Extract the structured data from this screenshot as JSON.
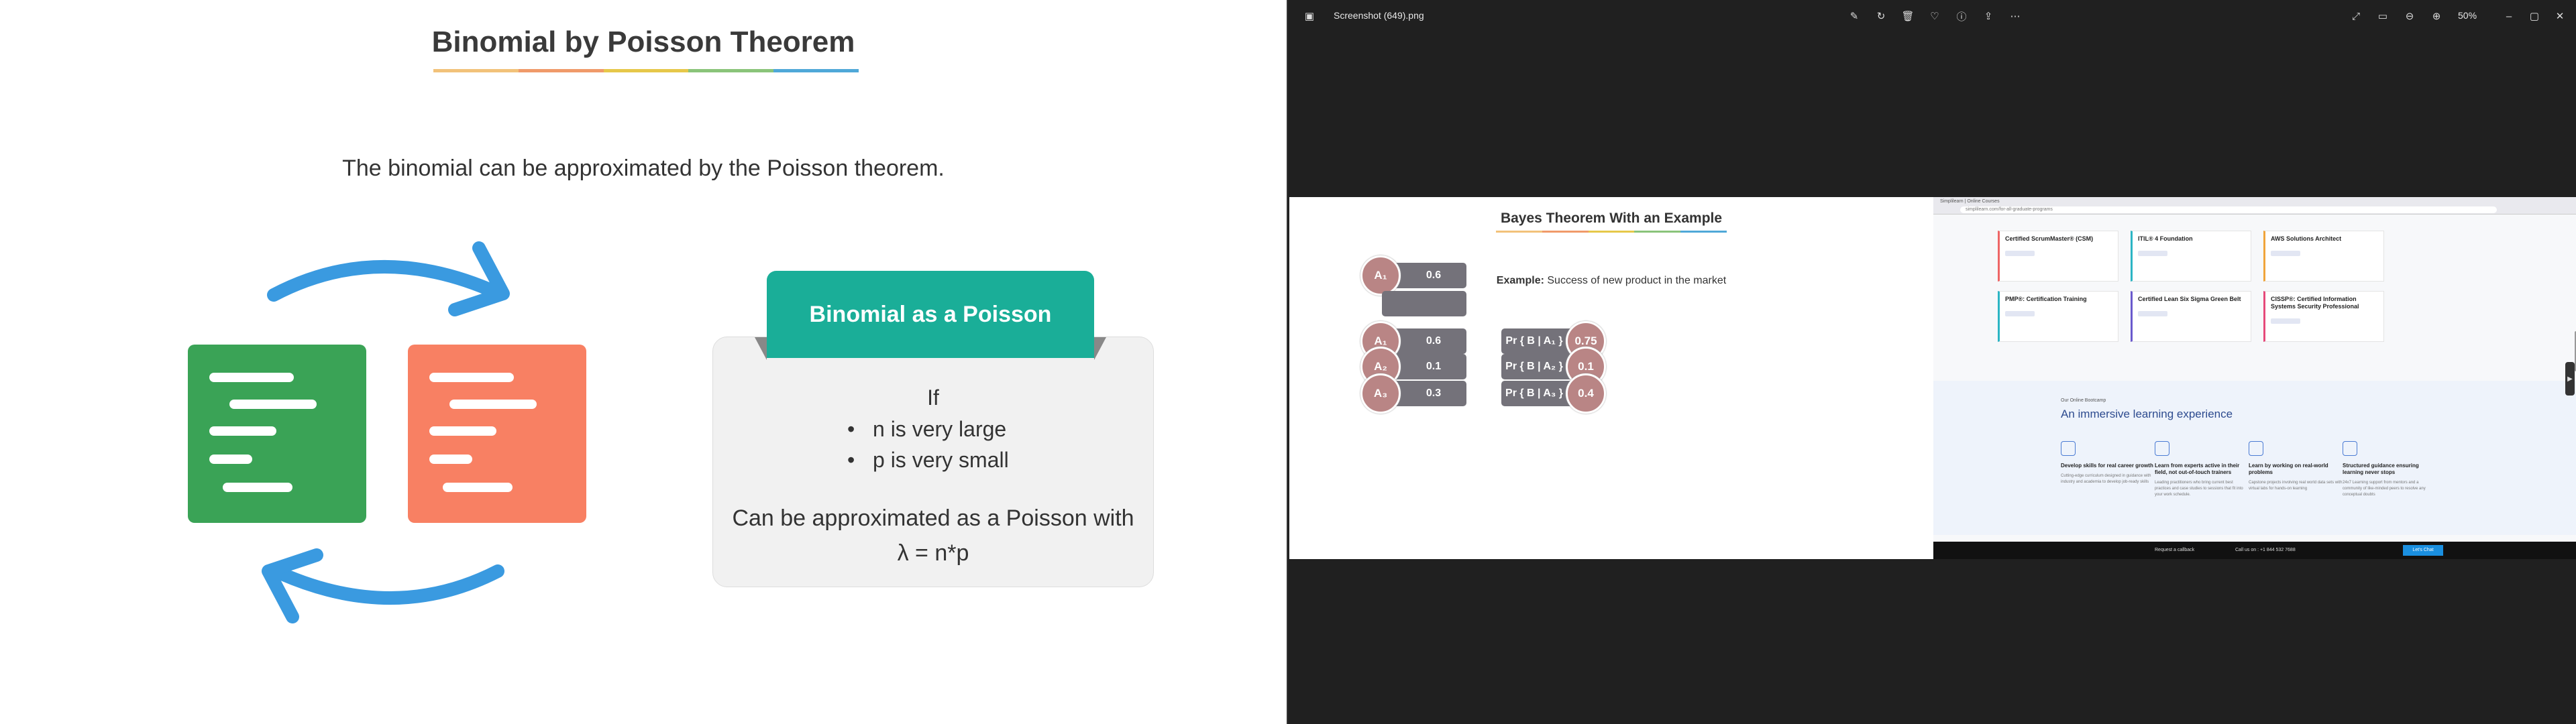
{
  "slide": {
    "title": "Binomial by Poisson Theorem",
    "underline_colors": [
      "#f2c27a",
      "#f09a6a",
      "#e6c84a",
      "#8ac47a",
      "#4fa8d8"
    ],
    "intro": "The binomial can be approximated by the Poisson theorem.",
    "card_header": "Binomial as a Poisson",
    "card_if": "If",
    "bullets": [
      "n is very large",
      "p is very small"
    ],
    "approx_line1": "Can be approximated as a Poisson with",
    "approx_line2": "λ = n*p",
    "colors": {
      "green_doc": "#3aa356",
      "orange_doc": "#f88063",
      "teal": "#1aae98",
      "arrow": "#3a9ae0"
    }
  },
  "viewer": {
    "filename": "Screenshot (649).png",
    "zoom": "50%",
    "screenshot": {
      "bayes": {
        "title": "Bayes Theorem With an Example",
        "example_label": "Example:",
        "example_text": " Success of new product in the market",
        "rows": [
          {
            "a_label": "A₁",
            "a_value": "0.6",
            "pr_label": "Pr { B | A₁ }",
            "pr_value": "0.75"
          },
          {
            "a_label": "A₂",
            "a_value": "0.1",
            "pr_label": "Pr { B | A₂ }",
            "pr_value": "0.1"
          },
          {
            "a_label": "A₃",
            "a_value": "0.3",
            "pr_label": "Pr { B | A₃ }",
            "pr_value": "0.4"
          }
        ]
      },
      "browser": {
        "tab_title": "Simplilearn | Online Courses",
        "url": "simplilearn.com/for-all-graduate-programs",
        "courses": [
          "Certified ScrumMaster® (CSM)",
          "ITIL® 4 Foundation",
          "AWS Solutions Architect",
          "PMP®: Certification Training",
          "Certified Lean Six Sigma Green Belt",
          "CISSP®: Certified Information Systems Security Professional"
        ],
        "eyebrow": "Our Online Bootcamp",
        "immersive_title": "An immersive learning experience",
        "features": [
          {
            "title": "Develop skills for real career growth",
            "desc": "Cutting-edge curriculum designed in guidance with industry and academia to develop job-ready skills"
          },
          {
            "title": "Learn from experts active in their field, not out-of-touch trainers",
            "desc": "Leading practitioners who bring current best practices and case studies to sessions that fit into your work schedule."
          },
          {
            "title": "Learn by working on real-world problems",
            "desc": "Capstone projects involving real world data sets with virtual labs for hands-on learning"
          },
          {
            "title": "Structured guidance ensuring learning never stops",
            "desc": "24x7 Learning support from mentors and a community of like-minded peers to resolve any conceptual doubts"
          }
        ],
        "footer": {
          "callback": "Request a callback",
          "call": "Call us on : +1 844 532 7688",
          "cta": "Let's Chat"
        }
      }
    }
  }
}
